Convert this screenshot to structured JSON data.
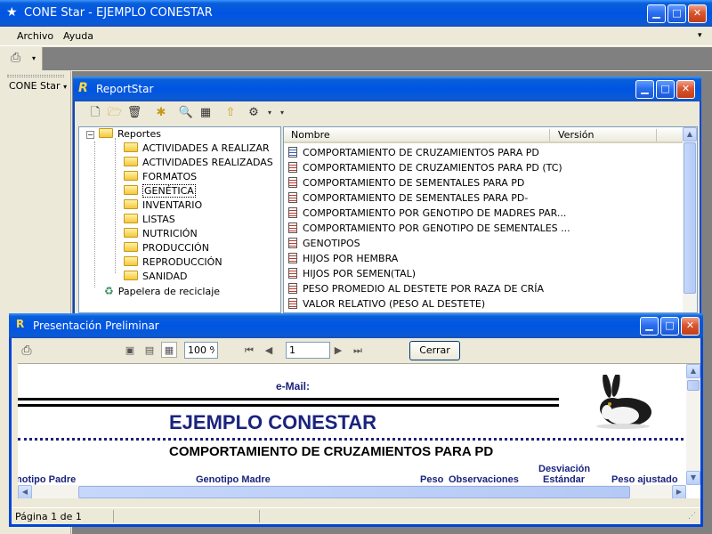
{
  "main_window": {
    "title": "CONE Star - EJEMPLO CONESTAR",
    "menu": [
      "Archivo",
      "Ayuda"
    ],
    "left_panel_label": "CONE Star",
    "controls": {
      "minimize": "▁",
      "maximize": "□",
      "close": "✕"
    }
  },
  "reportstar": {
    "title": "ReportStar",
    "tree": {
      "root": "Reportes",
      "folders": [
        "ACTIVIDADES A REALIZAR",
        "ACTIVIDADES REALIZADAS",
        "FORMATOS",
        "GENÉTICA",
        "INVENTARIO",
        "LISTAS",
        "NUTRICIÓN",
        "PRODUCCIÓN",
        "REPRODUCCIÓN",
        "SANIDAD"
      ],
      "selected": "GENÉTICA",
      "recycle": "Papelera de reciclaje"
    },
    "list": {
      "columns": [
        "Nombre",
        "Versión"
      ],
      "rows": [
        "COMPORTAMIENTO DE CRUZAMIENTOS PARA PD",
        "COMPORTAMIENTO DE CRUZAMIENTOS PARA PD (TC)",
        "COMPORTAMIENTO DE SEMENTALES PARA PD",
        "COMPORTAMIENTO DE SEMENTALES PARA PD-",
        "COMPORTAMIENTO POR GENOTIPO DE MADRES PAR...",
        "COMPORTAMIENTO POR GENOTIPO DE SEMENTALES ...",
        "GENOTIPOS",
        "HIJOS POR HEMBRA",
        "HIJOS POR SEMEN(TAL)",
        "PESO PROMEDIO AL DESTETE POR RAZA DE CRÍA",
        "VALOR RELATIVO (PESO AL DESTETE)"
      ]
    }
  },
  "preview": {
    "title": "Presentación Preliminar",
    "zoom": "100 %",
    "page": "1",
    "close_label": "Cerrar",
    "status": "Página 1 de 1",
    "report": {
      "email_label": "e-Mail:",
      "company": "EJEMPLO CONESTAR",
      "report_title": "COMPORTAMIENTO DE CRUZAMIENTOS PARA PD",
      "columns": [
        "notipo Padre",
        "Genotipo Madre",
        "Peso",
        "Observaciones",
        "Desviación",
        "Estándar",
        "Peso ajustado"
      ]
    }
  },
  "colors": {
    "xp_blue": "#0054e3",
    "report_navy": "#1a237e",
    "app_face": "#ece9d8"
  }
}
